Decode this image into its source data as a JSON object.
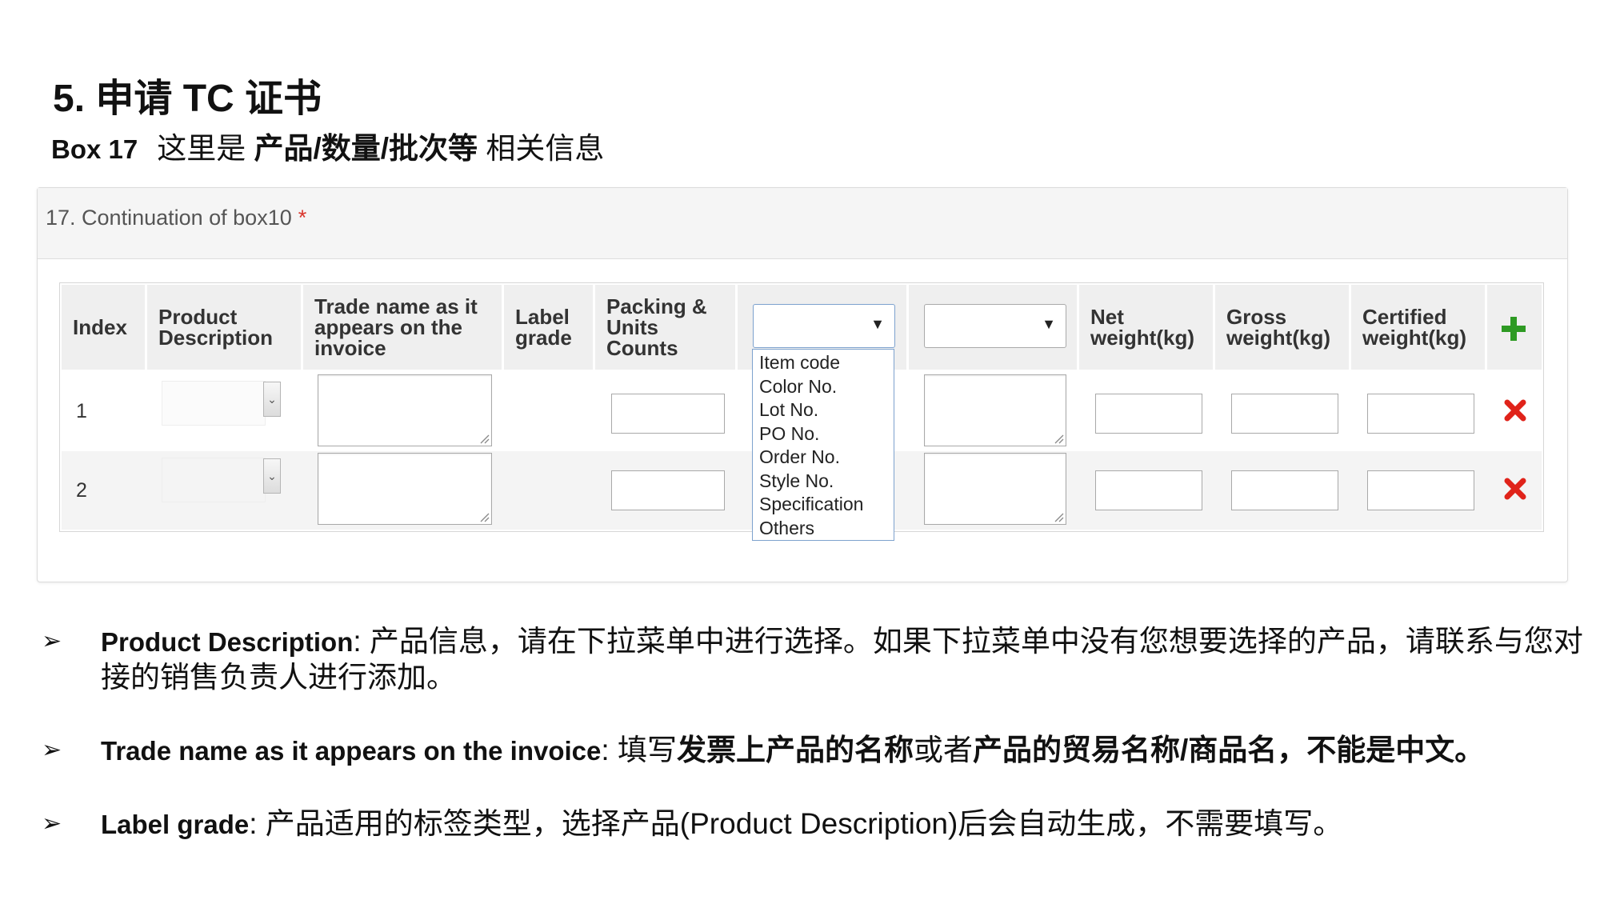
{
  "slide": {
    "title": "5. 申请 TC 证书",
    "subtitle_box": "Box 17",
    "subtitle_pre": "这里是",
    "subtitle_bold": "产品/数量/批次等",
    "subtitle_post": "相关信息"
  },
  "form": {
    "panel_title": "17. Continuation of box10",
    "required_mark": "*",
    "headers": {
      "index": "Index",
      "product_description": "Product Description",
      "trade_name": "Trade name as it appears on the invoice",
      "label_grade": "Label grade",
      "packing_units": "Packing & Units Counts",
      "net_weight": "Net weight(kg)",
      "gross_weight": "Gross weight(kg)",
      "certified_weight": "Certified weight(kg)"
    },
    "rows": [
      {
        "index": "1"
      },
      {
        "index": "2"
      }
    ],
    "dropdown_options": [
      "Item code",
      "Color No.",
      "Lot No.",
      "PO No.",
      "Order No.",
      "Style No.",
      "Specification",
      "Others"
    ],
    "icons": {
      "add": "plus-icon",
      "delete": "close-icon",
      "select_arrow": "triangle-down-icon"
    },
    "colors": {
      "add_green": "#2e9a23",
      "delete_red": "#e0231a",
      "required_red": "#d9342b",
      "dropdown_border": "#7da2ce"
    }
  },
  "bullets": [
    {
      "term": "Product Description",
      "text": ": 产品信息，请在下拉菜单中进行选择。如果下拉菜单中没有您想要选择的产品，请联系与您对接的销售负责人进行添加。"
    },
    {
      "term": "Trade name as it appears on the invoice",
      "t1": ": 填写",
      "b1": "发票上产品的名称",
      "t2": "或者",
      "b2": "产品的贸易名称/商品名，不能是中文。"
    },
    {
      "term": "Label grade",
      "text": ": 产品适用的标签类型，选择产品(Product Description)后会自动生成，不需要填写。"
    }
  ],
  "bullet_mark": "➢"
}
